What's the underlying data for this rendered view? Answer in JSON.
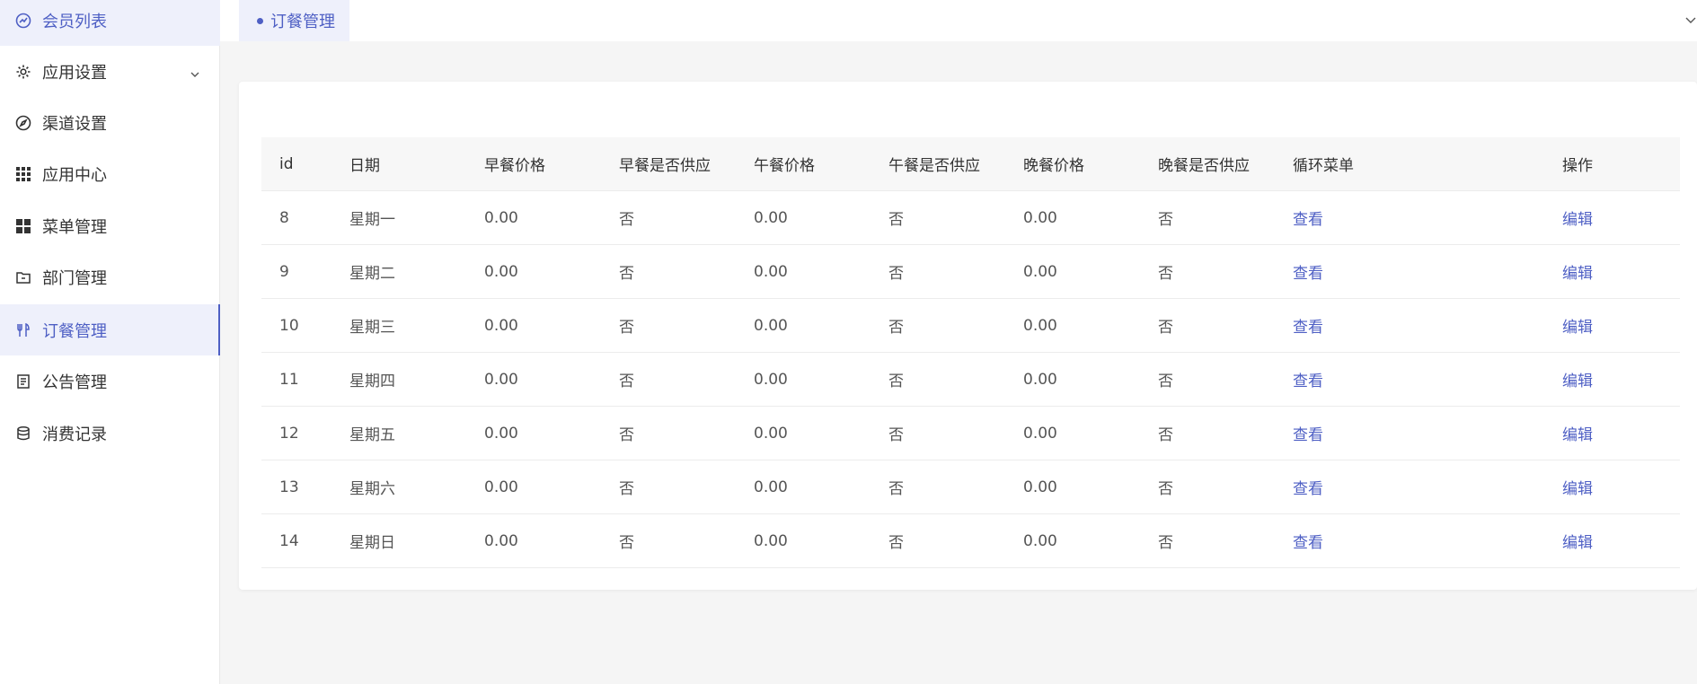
{
  "sidebar": {
    "items": [
      {
        "label": "会员列表",
        "icon": "dashboard-icon"
      },
      {
        "label": "应用设置",
        "icon": "gear-icon"
      },
      {
        "label": "渠道设置",
        "icon": "compass-icon"
      },
      {
        "label": "应用中心",
        "icon": "grid-icon"
      },
      {
        "label": "菜单管理",
        "icon": "apps-icon"
      },
      {
        "label": "部门管理",
        "icon": "folder-icon"
      },
      {
        "label": "订餐管理",
        "icon": "fork-knife-icon"
      },
      {
        "label": "公告管理",
        "icon": "document-icon"
      },
      {
        "label": "消费记录",
        "icon": "database-icon"
      }
    ]
  },
  "tabs": {
    "active_label": "订餐管理"
  },
  "table": {
    "headers": [
      "id",
      "日期",
      "早餐价格",
      "早餐是否供应",
      "午餐价格",
      "午餐是否供应",
      "晚餐价格",
      "晚餐是否供应",
      "循环菜单",
      "操作"
    ],
    "rows": [
      {
        "id": "8",
        "day": "星期一",
        "bp": "0.00",
        "bs": "否",
        "lp": "0.00",
        "ls": "否",
        "dp": "0.00",
        "ds": "否",
        "menu": "查看",
        "op": "编辑"
      },
      {
        "id": "9",
        "day": "星期二",
        "bp": "0.00",
        "bs": "否",
        "lp": "0.00",
        "ls": "否",
        "dp": "0.00",
        "ds": "否",
        "menu": "查看",
        "op": "编辑"
      },
      {
        "id": "10",
        "day": "星期三",
        "bp": "0.00",
        "bs": "否",
        "lp": "0.00",
        "ls": "否",
        "dp": "0.00",
        "ds": "否",
        "menu": "查看",
        "op": "编辑"
      },
      {
        "id": "11",
        "day": "星期四",
        "bp": "0.00",
        "bs": "否",
        "lp": "0.00",
        "ls": "否",
        "dp": "0.00",
        "ds": "否",
        "menu": "查看",
        "op": "编辑"
      },
      {
        "id": "12",
        "day": "星期五",
        "bp": "0.00",
        "bs": "否",
        "lp": "0.00",
        "ls": "否",
        "dp": "0.00",
        "ds": "否",
        "menu": "查看",
        "op": "编辑"
      },
      {
        "id": "13",
        "day": "星期六",
        "bp": "0.00",
        "bs": "否",
        "lp": "0.00",
        "ls": "否",
        "dp": "0.00",
        "ds": "否",
        "menu": "查看",
        "op": "编辑"
      },
      {
        "id": "14",
        "day": "星期日",
        "bp": "0.00",
        "bs": "否",
        "lp": "0.00",
        "ls": "否",
        "dp": "0.00",
        "ds": "否",
        "menu": "查看",
        "op": "编辑"
      }
    ]
  },
  "colors": {
    "accent": "#4e5fc4",
    "accent_bg": "#eef0fb"
  }
}
